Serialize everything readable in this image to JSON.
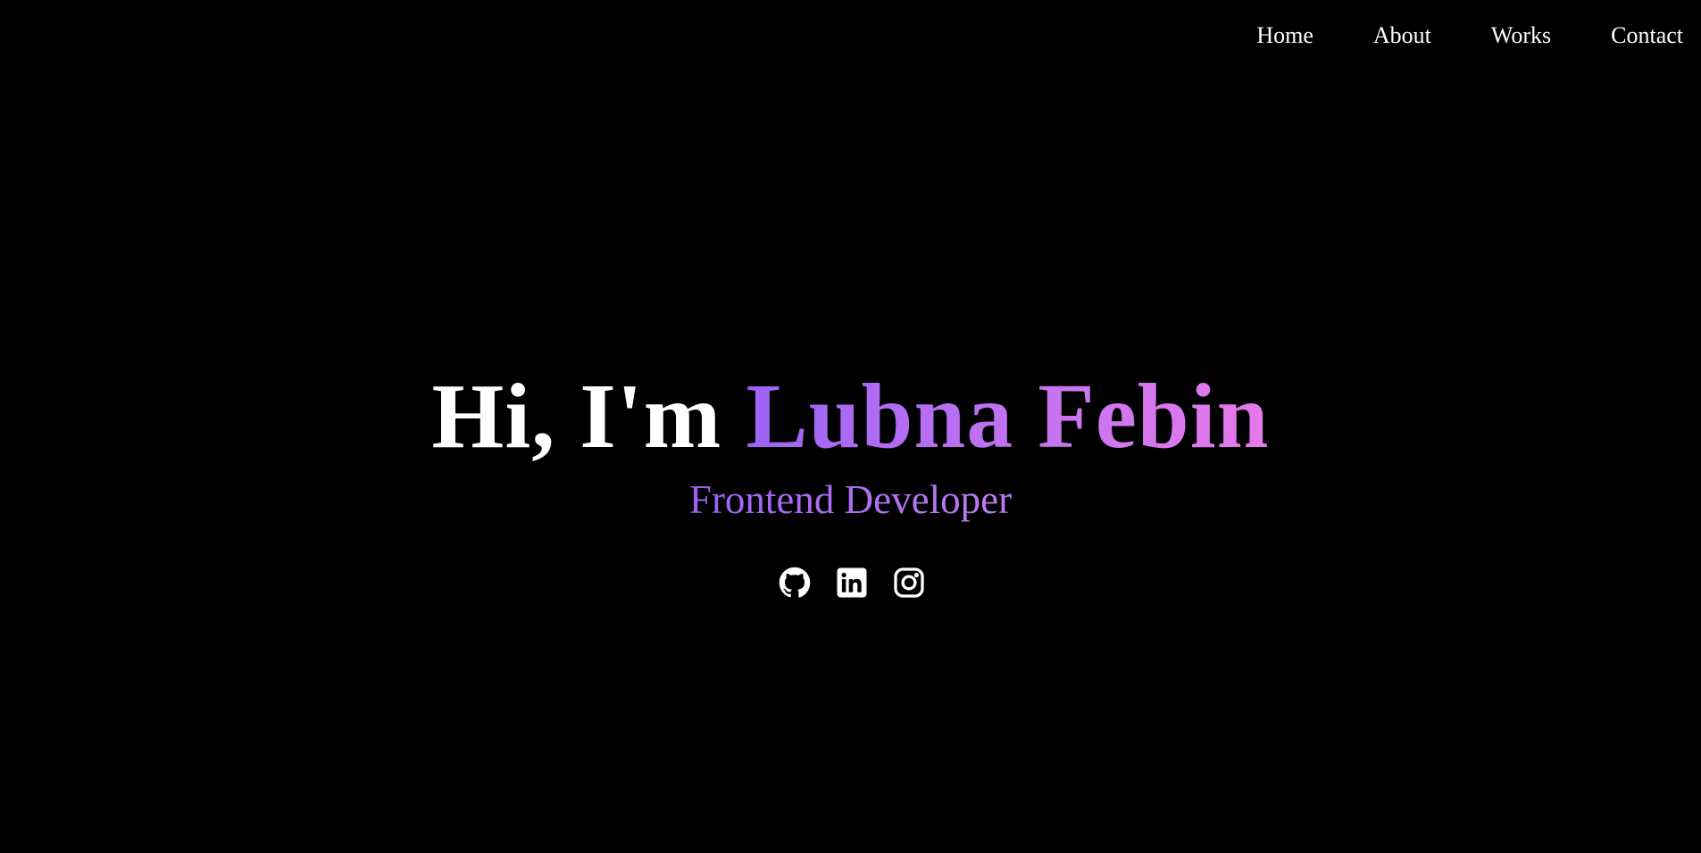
{
  "nav": {
    "items": [
      {
        "label": "Home"
      },
      {
        "label": "About"
      },
      {
        "label": "Works"
      },
      {
        "label": "Contact"
      }
    ]
  },
  "hero": {
    "greeting": "Hi, I'm ",
    "name": "Lubna Febin",
    "role": "Frontend Developer"
  },
  "socials": [
    {
      "icon": "github-icon"
    },
    {
      "icon": "linkedin-icon"
    },
    {
      "icon": "instagram-icon"
    }
  ],
  "colors": {
    "background": "#000000",
    "text": "#ffffff",
    "accent_start": "#9d63f3",
    "accent_end": "#e779ec"
  }
}
